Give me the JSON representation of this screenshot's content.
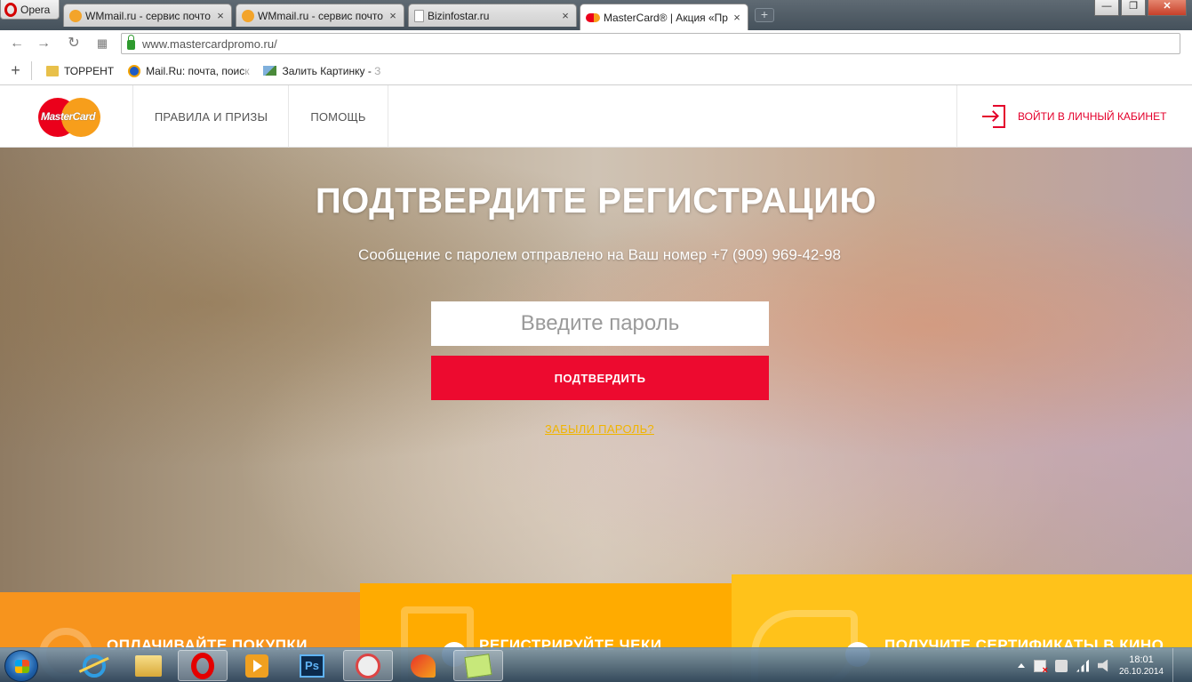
{
  "browser": {
    "menu_label": "Opera",
    "tabs": [
      {
        "label": "WMmail.ru - сервис почто",
        "close": "×"
      },
      {
        "label": "WMmail.ru - сервис почто",
        "close": "×"
      },
      {
        "label": "Bizinfostar.ru",
        "close": "×"
      },
      {
        "label": "MasterCard® | Акция «При",
        "close": "×"
      }
    ],
    "new_tab": "+",
    "window_buttons": {
      "minimize": "—",
      "maximize": "❐",
      "close": "✕"
    },
    "url": "www.mastercardpromo.ru/",
    "bookmarks": [
      {
        "label": "ТОРРЕНТ"
      },
      {
        "label": "Mail.Ru: почта, поис",
        "fade": "к"
      },
      {
        "label": "Залить Картинку -",
        "fade": "З"
      }
    ],
    "bookmark_add": "+"
  },
  "site": {
    "logo_text": "MasterCard",
    "nav": [
      {
        "label": "ПРАВИЛА И ПРИЗЫ"
      },
      {
        "label": "ПОМОЩЬ"
      }
    ],
    "login_label": "ВОЙТИ В ЛИЧНЫЙ КАБИНЕТ",
    "brand_red": "#e4002b"
  },
  "hero": {
    "title": "ПОДТВЕРДИТЕ РЕГИСТРАЦИЮ",
    "subtitle": "Сообщение с паролем отправлено на Ваш номер +7 (909) 969-42-98",
    "password_placeholder": "Введите пароль",
    "password_value": "",
    "confirm_label": "ПОДТВЕРДИТЬ",
    "forgot_label": "ЗАБЫЛИ ПАРОЛЬ?"
  },
  "steps": [
    {
      "label": "ОПЛАЧИВАЙТЕ ПОКУПКИ",
      "color": "#f7941d"
    },
    {
      "label": "РЕГИСТРИРУЙТЕ ЧЕКИ",
      "color": "#ffab00"
    },
    {
      "label": "ПОЛУЧИТЕ СЕРТИФИКАТЫ В КИНО",
      "color": "#ffc21a"
    }
  ],
  "taskbar": {
    "clock_time": "18:01",
    "clock_date": "26.10.2014"
  }
}
